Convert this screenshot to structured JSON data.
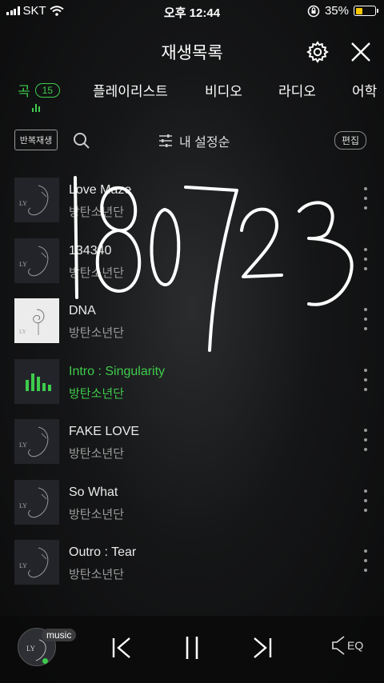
{
  "status_bar": {
    "carrier": "SKT",
    "time": "오후 12:44",
    "battery": "35%",
    "battery_level": 0.35
  },
  "header": {
    "title": "재생목록",
    "settings_icon": "gear-icon",
    "close_icon": "close-icon"
  },
  "tabs": [
    {
      "label": "곡",
      "count": "15",
      "active": true
    },
    {
      "label": "플레이리스트"
    },
    {
      "label": "비디오"
    },
    {
      "label": "라디오"
    },
    {
      "label": "어학"
    }
  ],
  "toolbar": {
    "repeat_label": "반복재생",
    "sort_label": "내 설정순",
    "edit_label": "편집"
  },
  "songs": [
    {
      "title": "Love Maze",
      "artist": "방탄소년단",
      "art": "dark"
    },
    {
      "title": "134340",
      "artist": "방탄소년단",
      "art": "dark"
    },
    {
      "title": "DNA",
      "artist": "방탄소년단",
      "art": "light"
    },
    {
      "title": "Intro : Singularity",
      "artist": "방탄소년단",
      "art": "dark",
      "playing": true
    },
    {
      "title": "FAKE LOVE",
      "artist": "방탄소년단",
      "art": "dark"
    },
    {
      "title": "So What",
      "artist": "방탄소년단",
      "art": "dark"
    },
    {
      "title": "Outro : Tear",
      "artist": "방탄소년단",
      "art": "dark"
    }
  ],
  "handwriting": "180723",
  "player": {
    "badge": "music",
    "eq_label": "EQ"
  },
  "colors": {
    "accent": "#3ecb4c",
    "battery": "#f7c600"
  }
}
